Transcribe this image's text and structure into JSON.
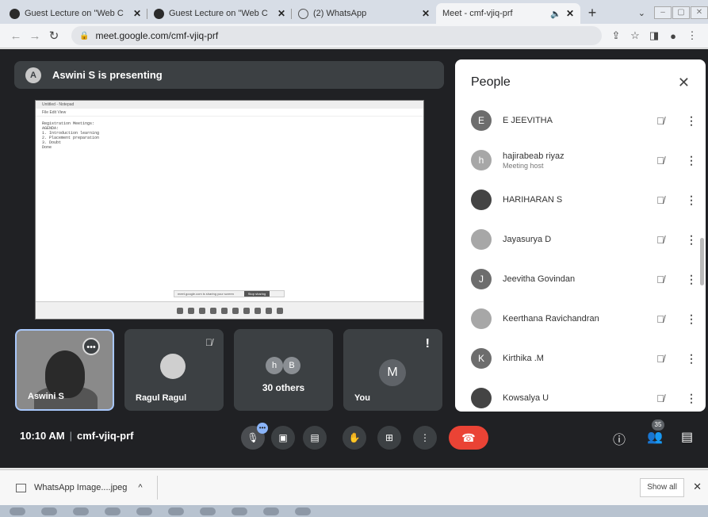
{
  "tabs": [
    {
      "title": "Guest Lecture on \"Web C",
      "icon": "chrome-favicon"
    },
    {
      "title": "Guest Lecture on \"Web C",
      "icon": "chrome-favicon"
    },
    {
      "title": "(2) WhatsApp",
      "icon": "whatsapp-favicon"
    },
    {
      "title": "Meet - cmf-vjiq-prf",
      "icon": "meet-favicon",
      "active": true
    }
  ],
  "address": {
    "url": "meet.google.com/cmf-vjiq-prf"
  },
  "banner": {
    "avatar": "A",
    "text": "Aswini S is presenting"
  },
  "notepad": {
    "title": "Untitled - Notepad",
    "menu": "File   Edit   View",
    "lines": [
      "Registration Meetings:",
      "",
      "AGENDA:",
      "1. Introduction learning",
      "2. Placement preparation",
      "3. Doubt",
      "Done"
    ],
    "share_text": "meet.google.com is sharing your screen",
    "stop_label": "Stop sharing",
    "hide_label": "Hide"
  },
  "tiles": {
    "self_name": "Aswini S",
    "ragul_name": "Ragul Ragul",
    "others_avatars": [
      "h",
      "B"
    ],
    "others_label": "30 others",
    "you_avatar": "M",
    "you_name": "You"
  },
  "people": {
    "title": "People",
    "list": [
      {
        "name": "E JEEVITHA",
        "avatar": "E",
        "role": ""
      },
      {
        "name": "hajirabeab riyaz",
        "avatar": "h",
        "role": "Meeting host"
      },
      {
        "name": "HARIHARAN S",
        "avatar": "",
        "role": ""
      },
      {
        "name": "Jayasurya D",
        "avatar": "",
        "role": ""
      },
      {
        "name": "Jeevitha Govindan",
        "avatar": "J",
        "role": ""
      },
      {
        "name": "Keerthana Ravichandran",
        "avatar": "",
        "role": ""
      },
      {
        "name": "Kirthika .M",
        "avatar": "K",
        "role": ""
      },
      {
        "name": "Kowsalya U",
        "avatar": "",
        "role": ""
      }
    ]
  },
  "controls": {
    "time": "10:10 AM",
    "divider": "|",
    "meeting_code": "cmf-vjiq-prf",
    "people_count": "35"
  },
  "downloads": {
    "file": "WhatsApp Image....jpeg",
    "show_all": "Show all"
  }
}
